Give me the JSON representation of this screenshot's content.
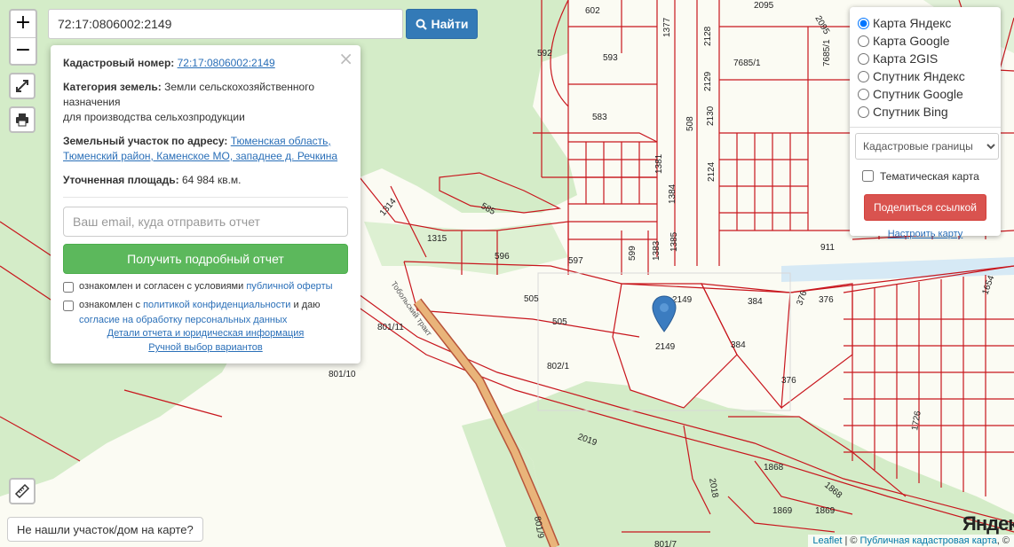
{
  "search": {
    "value": "72:17:0806002:2149",
    "button_label": "Найти"
  },
  "zoom": {
    "in_label": "+",
    "out_label": "−"
  },
  "popup": {
    "close_label": "×",
    "cadastral_label": "Кадастровый номер:",
    "cadastral_value": "72:17:0806002:2149",
    "category_label": "Категория земель:",
    "category_value_1": "Земли сельскохозяйственного",
    "category_value_2": "назначения",
    "category_value_3": "для производства сельхозпродукции",
    "address_label": "Земельный участок по адресу:",
    "address_value_1": "Тюменская область,",
    "address_value_2": "Тюменский район, Каменское МО, западнее д. Речкина",
    "area_label": "Уточненная площадь:",
    "area_value": "64 984 кв.м.",
    "email_placeholder": "Ваш email, куда отправить отчет",
    "report_button": "Получить подробный отчет",
    "consent_1_text": "ознакомлен и согласен с условиями",
    "consent_1_link": "публичной оферты",
    "consent_2_text_a": "ознакомлен с",
    "consent_2_link_a": "политикой конфиденциальности",
    "consent_2_text_b": "и даю",
    "consent_2_link_b": "согласие на обработку персональных данных",
    "details_link": "Детали отчета и юридическая информация",
    "manual_link": "Ручной выбор вариантов"
  },
  "layers": {
    "options": [
      "Карта Яндекс",
      "Карта Google",
      "Карта 2GIS",
      "Спутник Яндекс",
      "Спутник Google",
      "Спутник Bing"
    ],
    "selected": "Карта Яндекс",
    "overlay_select": "Кадастровые границы",
    "thematic_label": "Тематическая карта",
    "share_button": "Поделиться ссылкой",
    "setup_link": "Настроить карту"
  },
  "not_found_button": "Не нашли участок/дом на карте?",
  "attribution": {
    "leaflet": "Leaflet",
    "separator": "| ©",
    "pkk": "Публичная кадастровая карта",
    "tail": ", ©",
    "yandex": "Яндекс"
  },
  "map": {
    "road_label": "Тобольский тракт",
    "plot_labels": [
      "602",
      "593",
      "592",
      "583",
      "2095",
      "2095",
      "1377",
      "2128",
      "7685/1",
      "7685/1",
      "508",
      "2129",
      "2130",
      "1381",
      "1384",
      "2124",
      "1385",
      "1383",
      "585",
      "1314",
      "1315",
      "596",
      "597",
      "599",
      "911",
      "505",
      "505",
      "2149",
      "2149",
      "384",
      "384",
      "376",
      "376",
      "376",
      "1654",
      "801/11",
      "801/10",
      "802/1",
      "2019",
      "1868",
      "1868",
      "2018",
      "1726",
      "1869",
      "1869",
      "801/9",
      "801/7"
    ],
    "colors": {
      "land": "#fbfbf3",
      "forest": "#d4ecc8",
      "boundary": "#c8161d",
      "road": "#e9b47a",
      "road_edge": "#b7543a",
      "marker": "#3b7cc0"
    }
  }
}
